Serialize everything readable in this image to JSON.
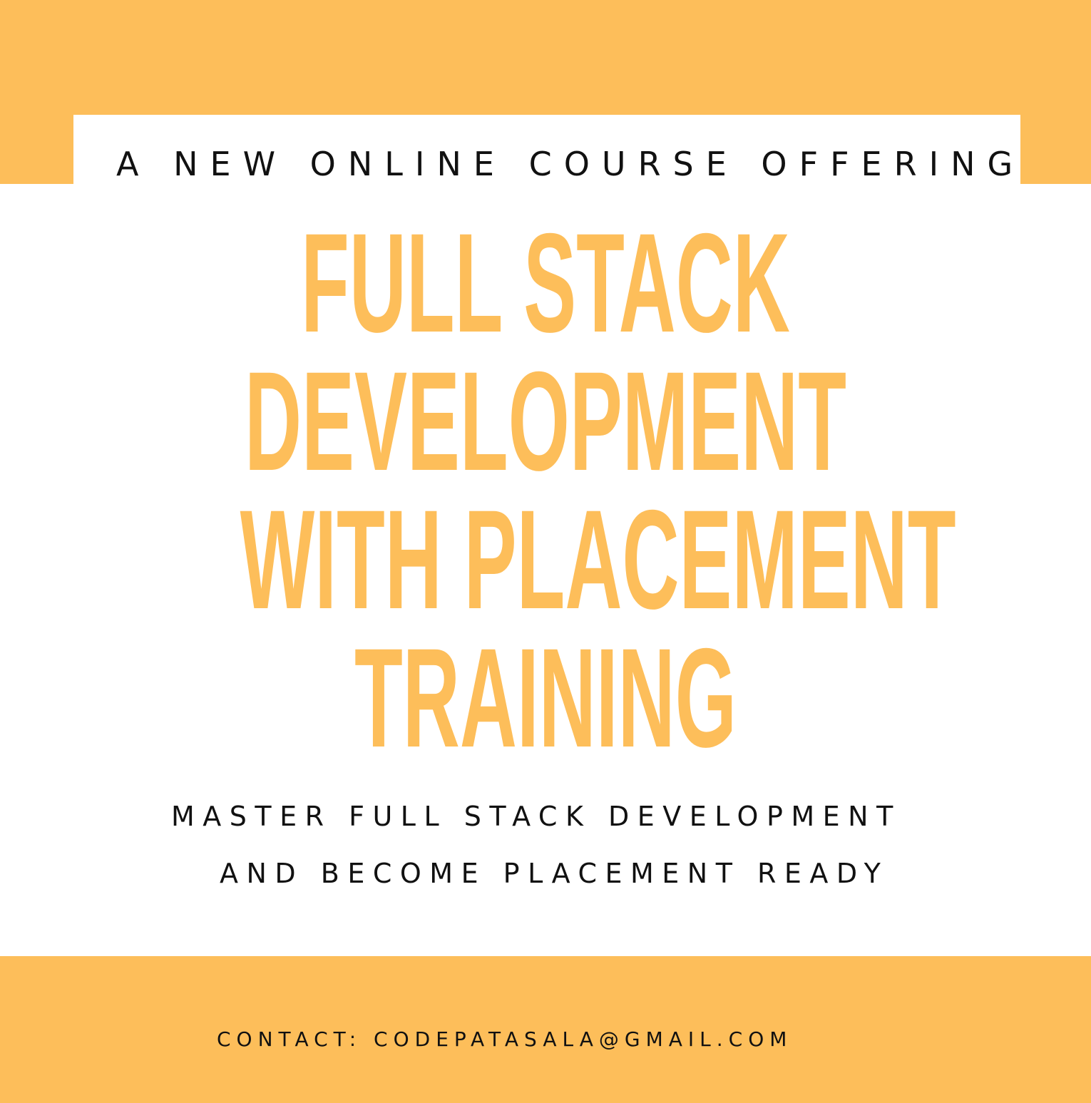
{
  "colors": {
    "accent": "#FDBE5A",
    "text": "#111111",
    "background": "#FFFFFF"
  },
  "header": {
    "eyebrow": "A NEW ONLINE COURSE OFFERING"
  },
  "title": {
    "lines": [
      "FULL STACK",
      "DEVELOPMENT",
      "WITH PLACEMENT",
      "TRAINING"
    ]
  },
  "subtitle": {
    "line1": "MASTER FULL STACK DEVELOPMENT",
    "line2": "AND BECOME PLACEMENT READY"
  },
  "footer": {
    "contact_label": "CONTACT:",
    "contact_email": "CODEPATASALA@GMAIL.COM"
  }
}
